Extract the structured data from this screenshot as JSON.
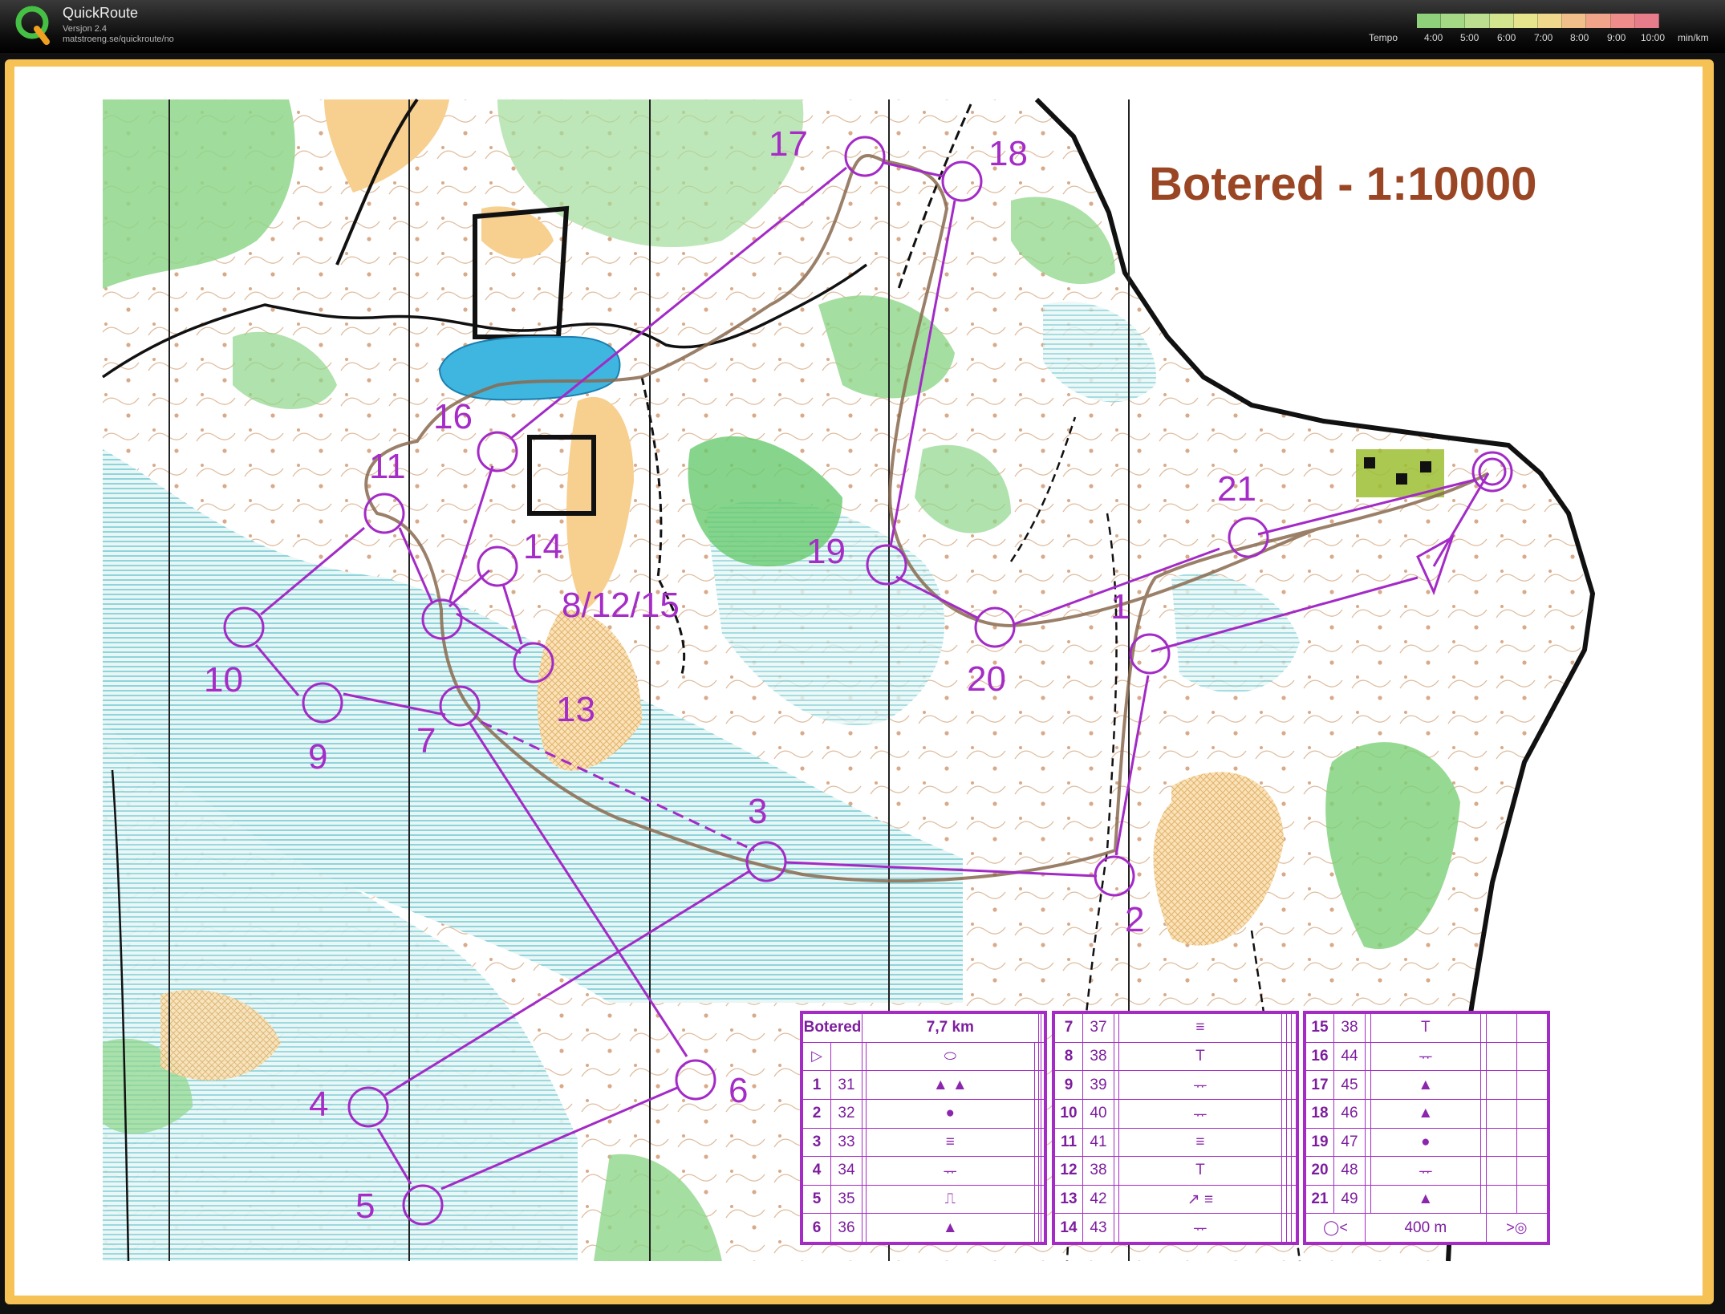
{
  "app": {
    "name": "QuickRoute",
    "version": "Versjon 2.4",
    "url": "matstroeng.se/quickroute/no",
    "tempo_label": "Tempo",
    "tempo_ticks": [
      "4:00",
      "5:00",
      "6:00",
      "7:00",
      "8:00",
      "9:00",
      "10:00",
      "min/km"
    ],
    "tempo_colors": [
      "#8fd07b",
      "#a4d885",
      "#bcdf8f",
      "#d3e48f",
      "#e6e58d",
      "#efd88b",
      "#f1c08a",
      "#f0a48a",
      "#ed8c8b",
      "#e77d8b"
    ]
  },
  "map": {
    "title": "Botered - 1:10000",
    "route_color": "#a32ac7",
    "gps_color": "#8a6a4f",
    "controls": [
      "1",
      "2",
      "3",
      "4",
      "5",
      "6",
      "7",
      "8/12/15",
      "9",
      "10",
      "11",
      "13",
      "14",
      "16",
      "17",
      "18",
      "19",
      "20",
      "21"
    ]
  },
  "control_descriptions": {
    "event": "Botered",
    "length": "7,7 km",
    "start_symbol": "triangle",
    "table1": [
      {
        "num": "1",
        "code": "31",
        "sym": "▲ ▲"
      },
      {
        "num": "2",
        "code": "32",
        "sym": "●"
      },
      {
        "num": "3",
        "code": "33",
        "sym": "≡"
      },
      {
        "num": "4",
        "code": "34",
        "sym": "ᅲ"
      },
      {
        "num": "5",
        "code": "35",
        "sym": "⎍"
      },
      {
        "num": "6",
        "code": "36",
        "sym": "▲"
      }
    ],
    "table2": [
      {
        "num": "7",
        "code": "37",
        "sym": "≡"
      },
      {
        "num": "8",
        "code": "38",
        "sym": "T"
      },
      {
        "num": "9",
        "code": "39",
        "sym": "ᅲ"
      },
      {
        "num": "10",
        "code": "40",
        "sym": "ᅲ"
      },
      {
        "num": "11",
        "code": "41",
        "sym": "≡"
      },
      {
        "num": "12",
        "code": "38",
        "sym": "T"
      },
      {
        "num": "13",
        "code": "42",
        "sym": "↗ ≡"
      },
      {
        "num": "14",
        "code": "43",
        "sym": "ᅲ"
      }
    ],
    "table3": [
      {
        "num": "15",
        "code": "38",
        "sym": "T"
      },
      {
        "num": "16",
        "code": "44",
        "sym": "ᅲ"
      },
      {
        "num": "17",
        "code": "45",
        "sym": "▲"
      },
      {
        "num": "18",
        "code": "46",
        "sym": "▲"
      },
      {
        "num": "19",
        "code": "47",
        "sym": "●"
      },
      {
        "num": "20",
        "code": "48",
        "sym": "ᅲ"
      },
      {
        "num": "21",
        "code": "49",
        "sym": "▲"
      }
    ],
    "finish_distance": "400 m"
  }
}
